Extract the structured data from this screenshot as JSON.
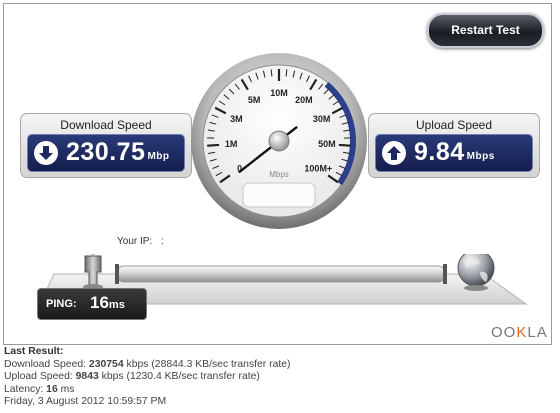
{
  "restart_button": {
    "label": "Restart Test"
  },
  "download": {
    "title": "Download Speed",
    "value": "230.75",
    "unit": "Mbp"
  },
  "upload": {
    "title": "Upload Speed",
    "value": "9.84",
    "unit": "Mbps"
  },
  "gauge": {
    "ticks": [
      "0",
      "1M",
      "3M",
      "5M",
      "10M",
      "20M",
      "30M",
      "50M",
      "100M+"
    ],
    "unit": "Mbps",
    "needle_fraction": 0.0,
    "arc_color": "#2b3f8c"
  },
  "ip": {
    "label": "Your IP:",
    "value": ":"
  },
  "ping": {
    "label": "PING:",
    "value": "16",
    "unit": "ms"
  },
  "logo": {
    "part1": "OO",
    "part2": "K",
    "part3": "LA"
  },
  "last_result": {
    "heading": "Last Result:",
    "download_prefix": "Download Speed: ",
    "download_value": "230754",
    "download_suffix": " kbps (28844.3 KB/sec transfer rate)",
    "upload_prefix": "Upload Speed: ",
    "upload_value": "9843",
    "upload_suffix": " kbps (1230.4 KB/sec transfer rate)",
    "latency_prefix": "Latency: ",
    "latency_value": "16",
    "latency_suffix": " ms",
    "date": "Friday, 3 August 2012 10:59:57 PM"
  },
  "colors": {
    "panel_blue": "#1c2760",
    "accent_orange": "#e06a1b"
  }
}
